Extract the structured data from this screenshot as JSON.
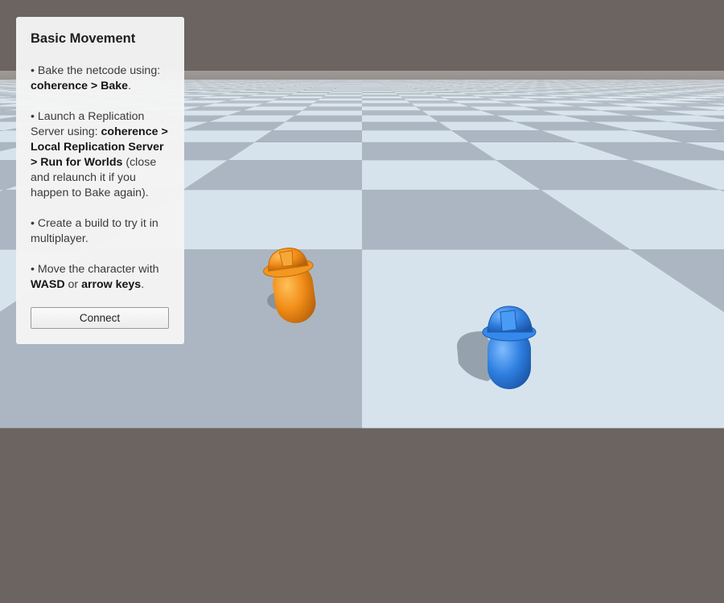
{
  "panel": {
    "title": "Basic Movement",
    "steps": [
      {
        "bullet": "• ",
        "text1": "Bake the netcode using: ",
        "bold1": "coherence > Bake",
        "text2": "."
      },
      {
        "bullet": "• ",
        "text1": "Launch a Replication Server using: ",
        "bold1": "coherence > Local Replication Server > Run for Worlds",
        "text2": " (close and relaunch it if you happen to Bake again)."
      },
      {
        "bullet": "• ",
        "text1": "Create a build to try it in multiplayer."
      },
      {
        "bullet": "• ",
        "text1": "Move the character with ",
        "bold1": "WASD",
        "text2": " or ",
        "bold2": "arrow keys",
        "text3": "."
      }
    ],
    "connect_label": "Connect"
  },
  "scene": {
    "sky_color": "#6b6460",
    "tile_light": "#d7e3ec",
    "tile_dark": "#abb6c2",
    "players": [
      {
        "name": "orange-player",
        "icon": "helmet-capsule",
        "color": "#f08c17"
      },
      {
        "name": "blue-player",
        "icon": "helmet-capsule",
        "color": "#2f7fe0"
      }
    ]
  }
}
